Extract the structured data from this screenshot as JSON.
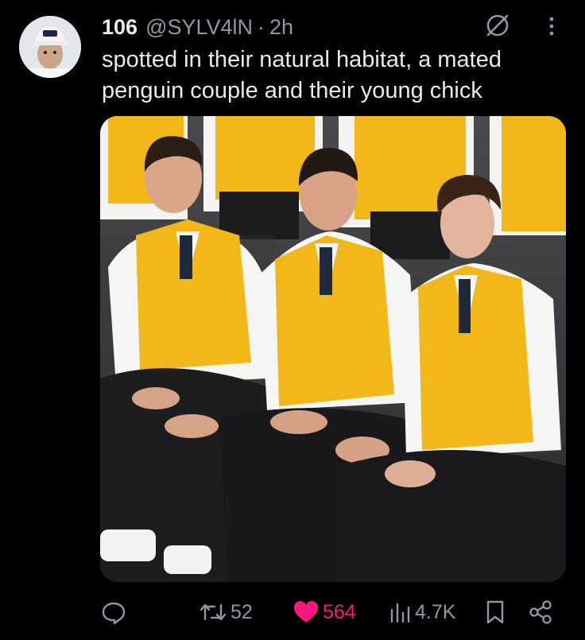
{
  "tweet": {
    "display_name": "106",
    "handle": "@SYLV4lN",
    "separator": "·",
    "time": "2h",
    "text": "spotted in their natural habitat,  a mated penguin couple and their young chick"
  },
  "icons": {
    "avatar": "user-avatar",
    "grok": "grok-icon",
    "more": "more-options-icon",
    "reply": "reply-icon",
    "retweet": "retweet-icon",
    "like": "heart-icon",
    "views": "views-icon",
    "bookmark": "bookmark-icon",
    "share": "share-icon"
  },
  "media": {
    "description_icon": "photo-of-three-men-in-yellow-vests"
  },
  "actions": {
    "replies": "",
    "retweets": "52",
    "likes": "564",
    "views": "4.7K"
  },
  "colors": {
    "background": "#000000",
    "text": "#e7e9ea",
    "secondary": "#8b98a5",
    "like": "#f91880",
    "vest": "#f2b718"
  }
}
